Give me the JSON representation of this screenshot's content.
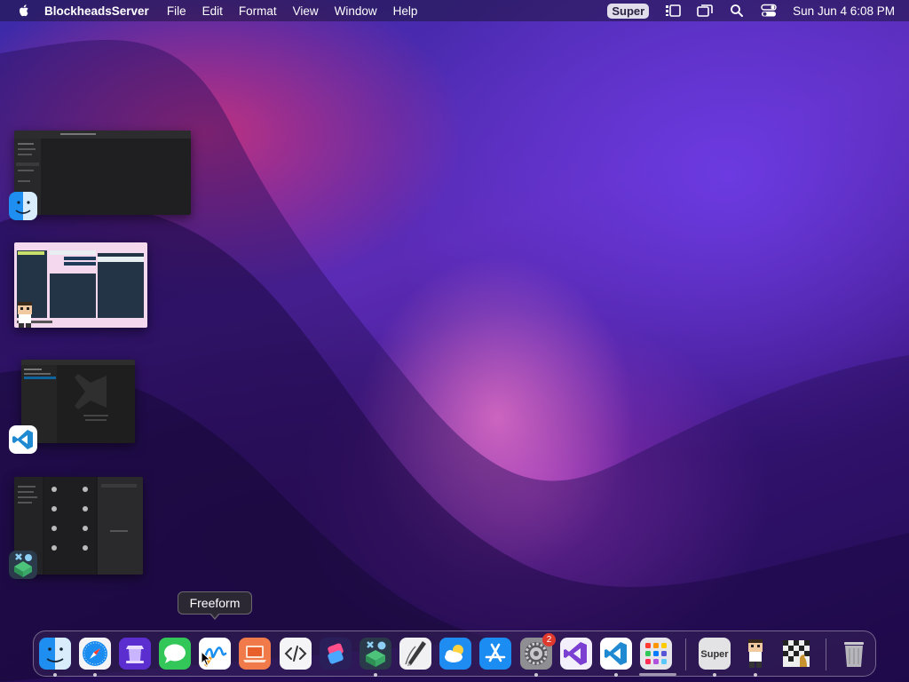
{
  "menubar": {
    "app_name": "BlockheadsServer",
    "menus": [
      "File",
      "Edit",
      "Format",
      "View",
      "Window",
      "Help"
    ],
    "super_label": "Super",
    "clock": "Sun Jun 4  6:08 PM"
  },
  "tooltip": {
    "label": "Freeform"
  },
  "dock": {
    "items": [
      {
        "name": "Finder",
        "icon": "finder-icon",
        "running": true
      },
      {
        "name": "Safari",
        "icon": "safari-icon",
        "running": true
      },
      {
        "name": "Podium",
        "icon": "podium-icon",
        "running": false
      },
      {
        "name": "Messages",
        "icon": "messages-icon",
        "running": false
      },
      {
        "name": "Freeform",
        "icon": "freeform-icon",
        "running": false
      },
      {
        "name": "Laptop",
        "icon": "laptop-icon",
        "running": false
      },
      {
        "name": "Code Editor",
        "icon": "code-editor-icon",
        "running": false
      },
      {
        "name": "Shortcuts",
        "icon": "shortcuts-icon",
        "running": false
      },
      {
        "name": "Blockheads",
        "icon": "blockheads-icon",
        "running": true
      },
      {
        "name": "Script Editor",
        "icon": "script-editor-icon",
        "running": false
      },
      {
        "name": "Weather",
        "icon": "weather-icon",
        "running": false
      },
      {
        "name": "App Store",
        "icon": "app-store-icon",
        "running": false
      },
      {
        "name": "System Settings",
        "icon": "settings-icon",
        "running": true,
        "badge": "2"
      },
      {
        "name": "Visual Studio",
        "icon": "visual-studio-icon",
        "running": false
      },
      {
        "name": "Visual Studio Code",
        "icon": "vscode-icon",
        "running": true
      },
      {
        "name": "Launchpad",
        "icon": "launchpad-icon",
        "running": false
      },
      {
        "name": "Super",
        "icon": "super-icon",
        "running": true,
        "label": "Super"
      },
      {
        "name": "Blockheads Server",
        "icon": "blockheads-server-icon",
        "running": true
      },
      {
        "name": "Chess",
        "icon": "chess-icon",
        "running": false
      },
      {
        "name": "Trash",
        "icon": "trash-icon",
        "running": false
      }
    ]
  },
  "colors": {
    "menubar_bg": "#1e143c",
    "tooltip_bg": "#2b2733",
    "badge": "#e03a2f"
  }
}
